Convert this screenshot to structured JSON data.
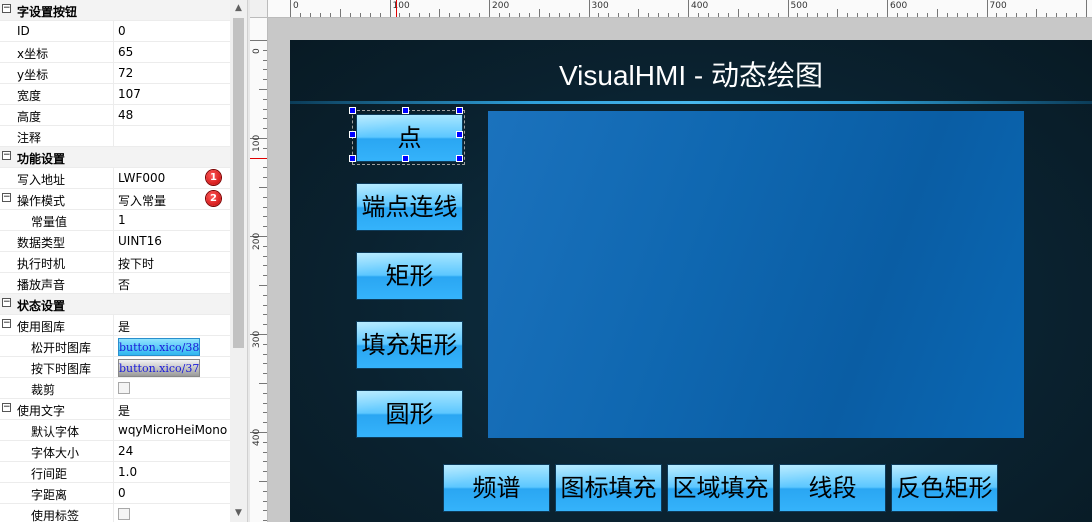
{
  "properties": [
    {
      "type": "cat",
      "toggle": "⊟",
      "label": "字设置按钮"
    },
    {
      "type": "prop",
      "label": "ID",
      "value": "0"
    },
    {
      "type": "prop",
      "label": "x坐标",
      "value": "65"
    },
    {
      "type": "prop",
      "label": "y坐标",
      "value": "72"
    },
    {
      "type": "prop",
      "label": "宽度",
      "value": "107"
    },
    {
      "type": "prop",
      "label": "高度",
      "value": "48"
    },
    {
      "type": "prop",
      "label": "注释",
      "value": ""
    },
    {
      "type": "cat",
      "toggle": "⊟",
      "label": "功能设置"
    },
    {
      "type": "prop",
      "label": "写入地址",
      "value": "LWF000",
      "badge": "1"
    },
    {
      "type": "prop",
      "label": "操作模式",
      "value": "写入常量",
      "badge": "2",
      "toggle": "⊟"
    },
    {
      "type": "prop",
      "label": "常量值",
      "value": "1",
      "indent": true
    },
    {
      "type": "prop",
      "label": "数据类型",
      "value": "UINT16"
    },
    {
      "type": "prop",
      "label": "执行时机",
      "value": "按下时"
    },
    {
      "type": "prop",
      "label": "播放声音",
      "value": "否"
    },
    {
      "type": "cat",
      "toggle": "⊟",
      "label": "状态设置"
    },
    {
      "type": "prop",
      "label": "使用图库",
      "value": "是",
      "toggle": "⊟"
    },
    {
      "type": "prop",
      "label": "松开时图库",
      "value": "button.xico/38",
      "image": "blue",
      "indent": true
    },
    {
      "type": "prop",
      "label": "按下时图库",
      "value": "button.xico/37",
      "image": "gray",
      "indent": true
    },
    {
      "type": "prop",
      "label": "裁剪",
      "value": "",
      "check": true,
      "indent": true
    },
    {
      "type": "prop",
      "label": "使用文字",
      "value": "是",
      "toggle": "⊟"
    },
    {
      "type": "prop",
      "label": "默认字体",
      "value": "wqyMicroHeiMono",
      "indent": true
    },
    {
      "type": "prop",
      "label": "字体大小",
      "value": "24",
      "indent": true
    },
    {
      "type": "prop",
      "label": "行间距",
      "value": "1.0",
      "indent": true
    },
    {
      "type": "prop",
      "label": "字距离",
      "value": "0",
      "indent": true
    },
    {
      "type": "prop",
      "label": "使用标签",
      "value": "",
      "check": true,
      "indent": true
    }
  ],
  "scrollbar": {
    "up": "▲",
    "down": "▼"
  },
  "ruler": {
    "h_labels": [
      "0",
      "100",
      "200",
      "300",
      "400",
      "500",
      "600",
      "700"
    ],
    "v_labels": [
      "0",
      "100",
      "200",
      "300",
      "400"
    ]
  },
  "screen": {
    "title": "VisualHMI - 动态绘图",
    "side_buttons": [
      "点",
      "端点连线",
      "矩形",
      "填充矩形",
      "圆形"
    ],
    "bottom_buttons": [
      "频谱",
      "图标填充",
      "区域填充",
      "线段",
      "反色矩形"
    ]
  },
  "colors": {
    "screen_bg": "#0a2230",
    "draw_area": "#0f67b0",
    "button_top": "#a6e6ff",
    "button_bottom": "#2aa6f2",
    "selection_handle": "#0000ff",
    "badge": "#d40000"
  }
}
